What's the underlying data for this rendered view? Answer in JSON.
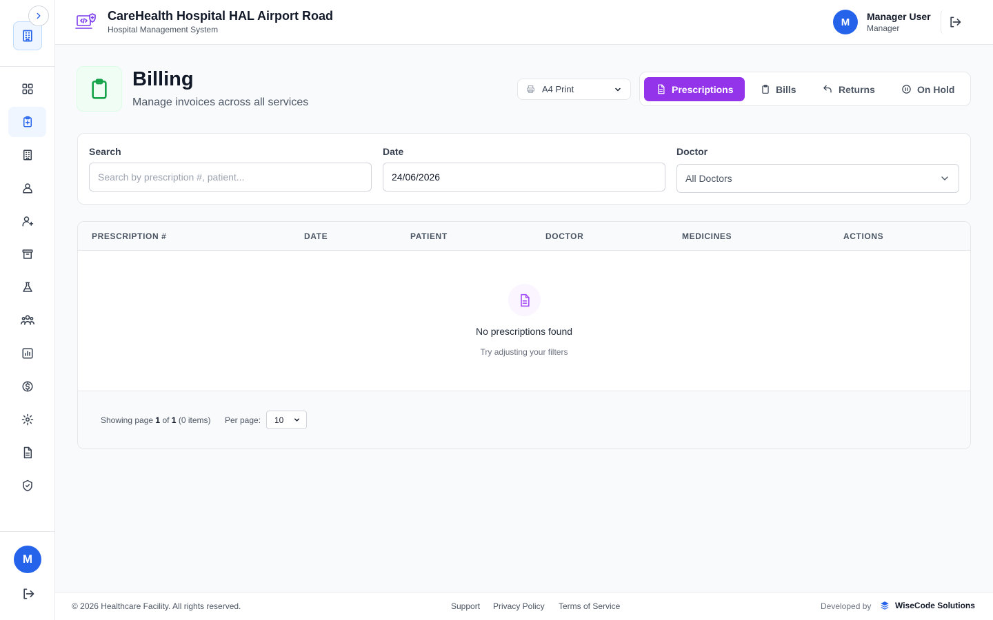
{
  "header": {
    "title": "CareHealth Hospital HAL Airport Road",
    "subtitle": "Hospital Management System",
    "user": {
      "initial": "M",
      "name": "Manager User",
      "role": "Manager"
    }
  },
  "sidebar": {
    "avatar_initial": "M",
    "items": [
      {
        "icon": "dashboard-icon",
        "active": false
      },
      {
        "icon": "clipboard-plus-icon",
        "active": true
      },
      {
        "icon": "hospital-building-icon",
        "active": false
      },
      {
        "icon": "users-icon",
        "active": false
      },
      {
        "icon": "user-plus-icon",
        "active": false
      },
      {
        "icon": "archive-icon",
        "active": false
      },
      {
        "icon": "flask-icon",
        "active": false
      },
      {
        "icon": "user-group-icon",
        "active": false
      },
      {
        "icon": "bar-chart-icon",
        "active": false
      },
      {
        "icon": "dollar-icon",
        "active": false
      },
      {
        "icon": "gear-icon",
        "active": false
      },
      {
        "icon": "document-icon",
        "active": false
      },
      {
        "icon": "shield-check-icon",
        "active": false
      },
      {
        "icon": "bell-icon",
        "active": false
      }
    ]
  },
  "page": {
    "title": "Billing",
    "subtitle": "Manage invoices across all services",
    "print_option": "A4 Print",
    "tabs": [
      {
        "label": "Prescriptions",
        "icon": "document-icon",
        "active": true
      },
      {
        "label": "Bills",
        "icon": "clipboard-icon",
        "active": false
      },
      {
        "label": "Returns",
        "icon": "undo-arrow-icon",
        "active": false
      },
      {
        "label": "On Hold",
        "icon": "pause-circle-icon",
        "active": false
      }
    ]
  },
  "filters": {
    "search_label": "Search",
    "search_placeholder": "Search by prescription #, patient...",
    "date_label": "Date",
    "date_value": "24/06/2026",
    "doctor_label": "Doctor",
    "doctor_value": "All Doctors"
  },
  "table": {
    "columns": [
      "PRESCRIPTION #",
      "DATE",
      "PATIENT",
      "DOCTOR",
      "MEDICINES",
      "ACTIONS"
    ],
    "empty_title": "No prescriptions found",
    "empty_subtitle": "Try adjusting your filters",
    "pagination": {
      "prefix": "Showing page",
      "page": "1",
      "of": "of",
      "total_pages": "1",
      "items": "(0 items)",
      "per_page_label": "Per page:",
      "per_page_value": "10"
    }
  },
  "footer": {
    "copyright": "© 2026 Healthcare Facility. All rights reserved.",
    "links": [
      "Support",
      "Privacy Policy",
      "Terms of Service"
    ],
    "developed_by": "Developed by",
    "brand": "WiseCode Solutions"
  },
  "colors": {
    "accent_purple": "#9333ea",
    "primary_blue": "#2563eb",
    "success_green": "#16a34a"
  }
}
